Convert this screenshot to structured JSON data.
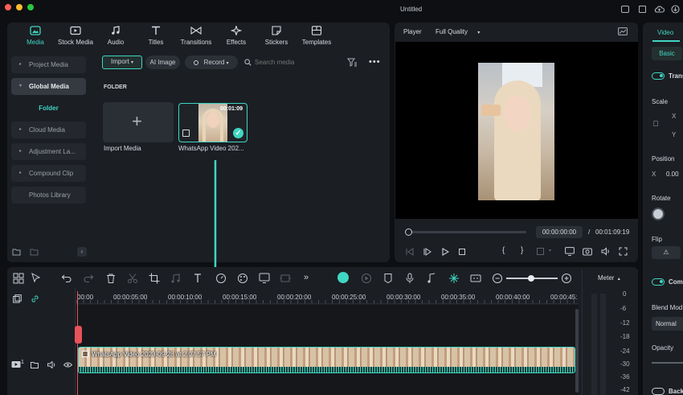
{
  "window": {
    "title": "Untitled"
  },
  "media_tabs": [
    {
      "label": "Media",
      "icon": "media-icon"
    },
    {
      "label": "Stock Media",
      "icon": "stock-media-icon"
    },
    {
      "label": "Audio",
      "icon": "music-note-icon"
    },
    {
      "label": "Titles",
      "icon": "text-t-icon"
    },
    {
      "label": "Transitions",
      "icon": "transitions-icon"
    },
    {
      "label": "Effects",
      "icon": "sparkle-icon"
    },
    {
      "label": "Stickers",
      "icon": "sticker-icon"
    },
    {
      "label": "Templates",
      "icon": "templates-icon"
    }
  ],
  "sidebar": {
    "items": [
      {
        "label": "Project Media"
      },
      {
        "label": "Global Media"
      },
      {
        "label": "Folder"
      },
      {
        "label": "Cloud Media"
      },
      {
        "label": "Adjustment La..."
      },
      {
        "label": "Compound Clip"
      },
      {
        "label": "Photos Library"
      }
    ]
  },
  "media_toolbar": {
    "import": "Import",
    "ai_image": "AI Image",
    "record": "Record",
    "search_placeholder": "Search media"
  },
  "media_grid": {
    "folder_label": "FOLDER",
    "import_tile_label": "Import Media",
    "clip": {
      "name": "WhatsApp Video 202...",
      "duration": "00:01:09"
    }
  },
  "player": {
    "label": "Player",
    "quality": "Full Quality",
    "current_time": "00:00:00:00",
    "separator": "/",
    "total_time": "00:01:09:19",
    "progress_fraction": 0.0
  },
  "inspector": {
    "tab": "Video",
    "subtab": "Basic",
    "transform": "Trans",
    "scale": "Scale",
    "x": "X",
    "y": "Y",
    "position": "Position",
    "pos_x_label": "X",
    "pos_x_value": "0.00",
    "rotate": "Rotate",
    "flip": "Flip",
    "compositing": "Com",
    "blend_mode": "Blend Mod",
    "blend_value": "Normal",
    "opacity": "Opacity",
    "background": "Back"
  },
  "timeline": {
    "ticks": [
      "00:00",
      "00:00:05:00",
      "00:00:10:00",
      "00:00:15:00",
      "00:00:20:00",
      "00:00:25:00",
      "00:00:30:00",
      "00:00:35:00",
      "00:00:40:00",
      "00:00:45:"
    ],
    "clip_name": "WhatsApp Video 2023-09-28 at 2.07.57 PM",
    "track_number": "1"
  },
  "meter": {
    "label": "Meter",
    "scale": [
      "0",
      "-6",
      "-12",
      "-18",
      "-24",
      "-30",
      "-36",
      "-42"
    ]
  },
  "colors": {
    "accent": "#3fd6c2",
    "panel": "#1b1e23",
    "background": "#0d0f12"
  }
}
